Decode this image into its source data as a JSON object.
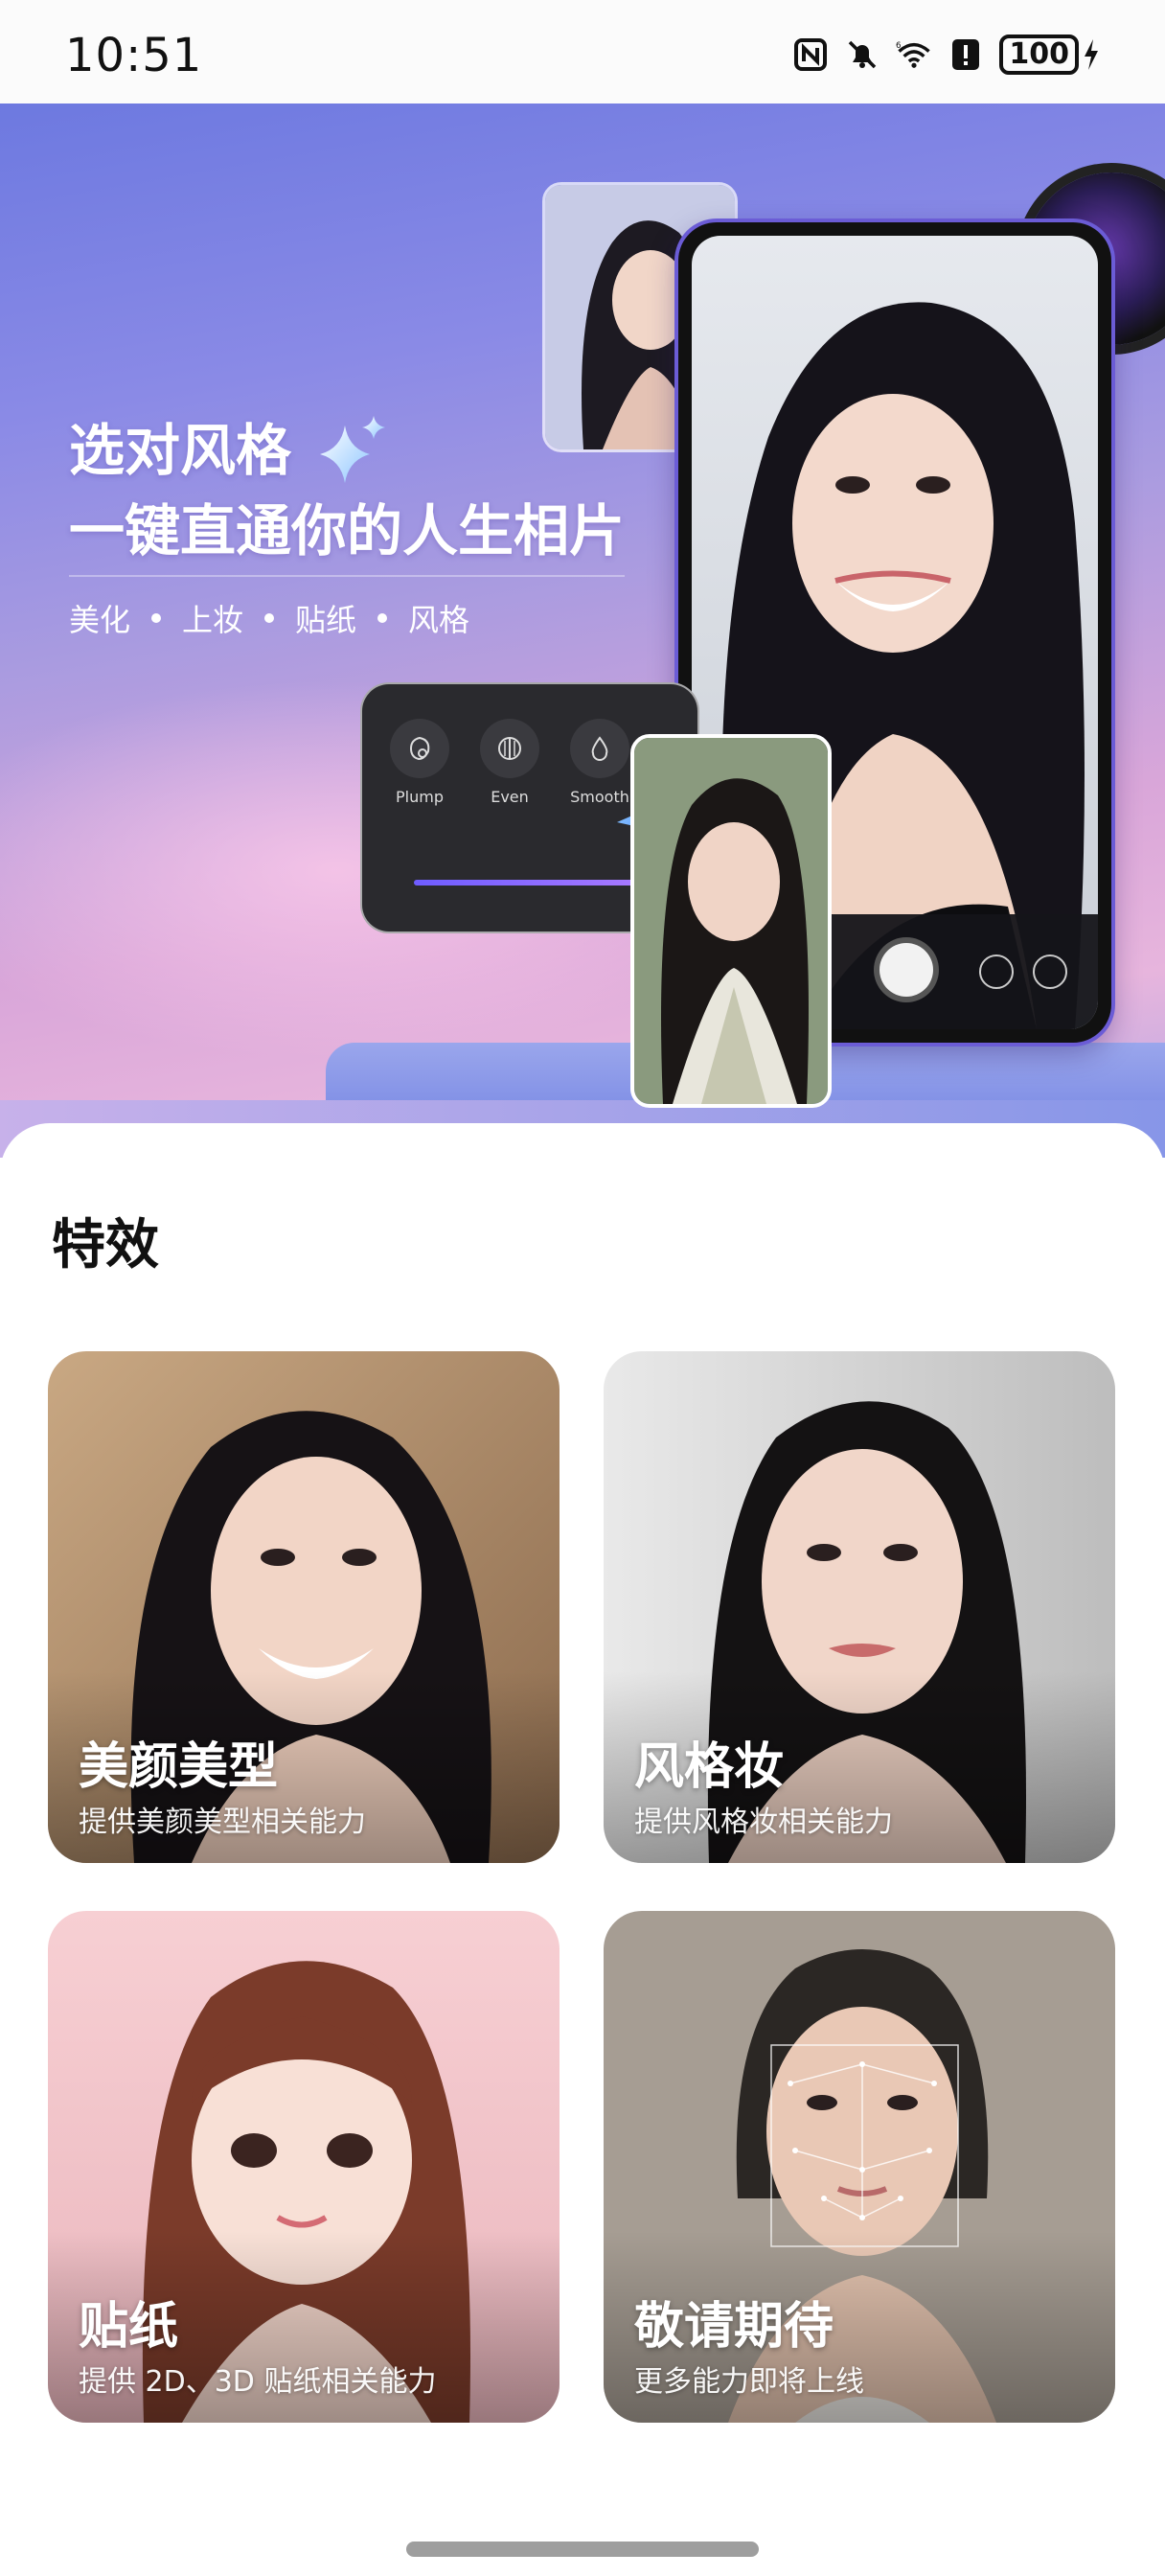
{
  "status_bar": {
    "time": "10:51",
    "icons": [
      "nfc-icon",
      "mute-bell-icon",
      "wifi-6-icon",
      "alert-icon"
    ],
    "battery": "100",
    "charging": true
  },
  "hero": {
    "title_line1": "选对风格",
    "title_line2": "一键直通你的人生相片",
    "tags": [
      "美化",
      "上妆",
      "贴纸",
      "风格"
    ],
    "panel_options": [
      {
        "label": "Plump"
      },
      {
        "label": "Even"
      },
      {
        "label": "Smooth"
      }
    ]
  },
  "section": {
    "title": "特效",
    "cards": [
      {
        "title": "美颜美型",
        "desc": "提供美颜美型相关能力"
      },
      {
        "title": "风格妆",
        "desc": "提供风格妆相关能力"
      },
      {
        "title": "贴纸",
        "desc": "提供 2D、3D 贴纸相关能力"
      },
      {
        "title": "敬请期待",
        "desc": "更多能力即将上线"
      }
    ]
  },
  "colors": {
    "accent": "#6e5cff",
    "hero_top": "#6d79e0",
    "hero_bottom": "#e7b5dd"
  }
}
